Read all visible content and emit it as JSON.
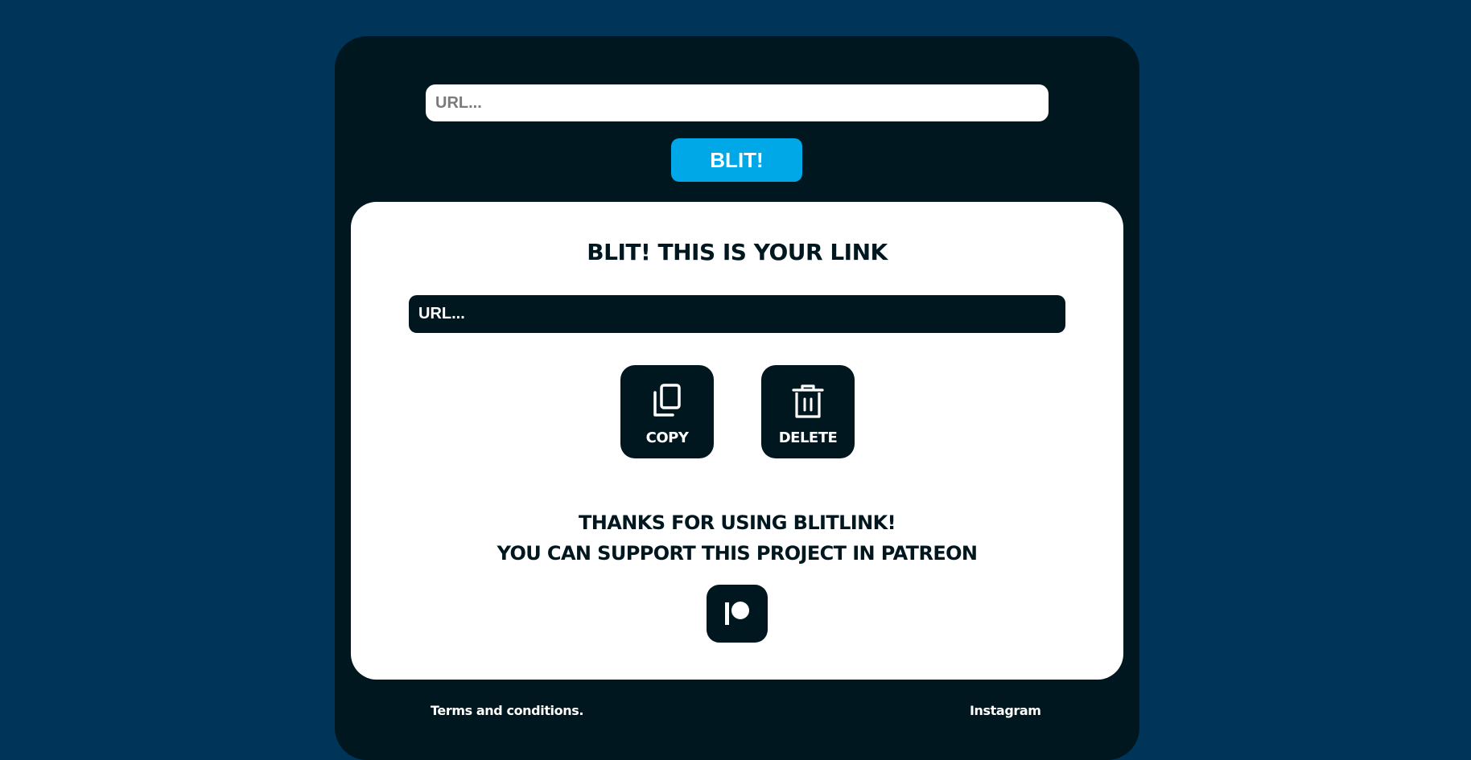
{
  "shortener": {
    "url_placeholder": "URL...",
    "url_value": "",
    "submit_label": "BLIT!"
  },
  "result": {
    "title": "BLIT! THIS IS YOUR LINK",
    "link_placeholder": "URL...",
    "link_value": "",
    "copy_label": "COPY",
    "copy_icon": "copy-icon",
    "delete_label": "DELETE",
    "delete_icon": "trash-icon"
  },
  "support": {
    "line1": "THANKS FOR USING BLITLINK!",
    "line2": "YOU CAN SUPPORT THIS PROJECT IN PATREON",
    "patreon_icon": "patreon-icon"
  },
  "footer": {
    "terms_label": "Terms and conditions.",
    "instagram_label": "Instagram"
  },
  "colors": {
    "page_background": "#003459",
    "panel": "#00171f",
    "accent": "#00a8e8",
    "card": "#ffffff"
  }
}
